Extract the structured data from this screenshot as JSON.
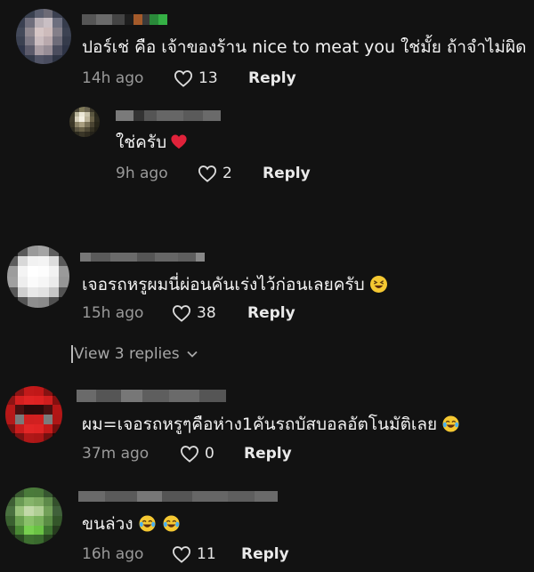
{
  "comments": [
    {
      "text": "ปอร์เช่ คือ เจ้าของร้าน nice to meat you ใช่มั้ย ถ้าจำไม่ผิด",
      "time": "14h ago",
      "likes": "13",
      "reply_label": "Reply"
    },
    {
      "text": "ใช่ครับ",
      "emoji": "red-heart",
      "time": "9h ago",
      "likes": "2",
      "reply_label": "Reply",
      "is_reply": true
    },
    {
      "text": "เจอรถหรูผมนี่ผ่อนคันเร่งไว้ก่อนเลยครับ",
      "emoji": "laughing-squint",
      "time": "15h ago",
      "likes": "38",
      "reply_label": "Reply"
    },
    {
      "text": "ผม=เจอรถหรูๆคือห่าง1คันรถบัสบอลอัตโนมัติเลย",
      "emoji": "tears-of-joy",
      "time": "37m ago",
      "likes": "0",
      "reply_label": "Reply"
    },
    {
      "text": "ขนล่วง",
      "emoji": "tears-of-joy x2",
      "time": "16h ago",
      "likes": "11",
      "reply_label": "Reply"
    }
  ],
  "view_replies": {
    "label": "View 3 replies"
  },
  "colors": {
    "background": "#121212",
    "text": "#f2f2f2",
    "muted": "#9a9a9a",
    "heart_emoji": "#e0223a",
    "emoji_yellow": "#f5c832"
  }
}
